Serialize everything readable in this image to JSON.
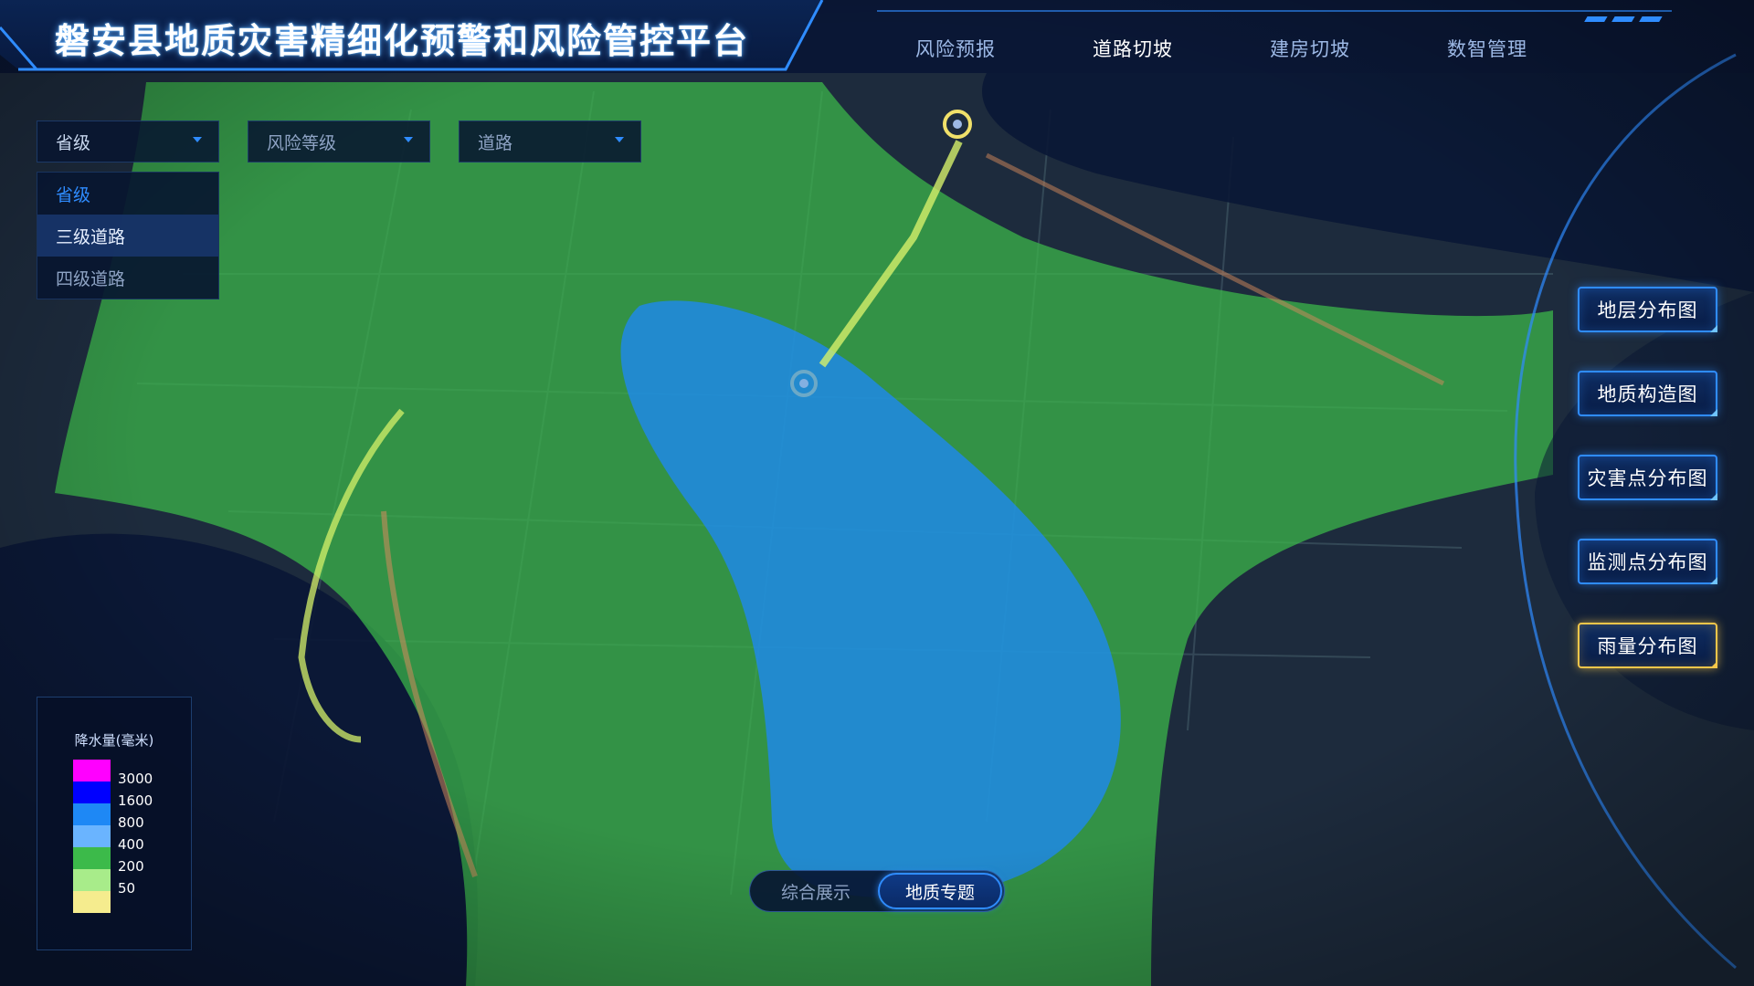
{
  "header": {
    "title": "磐安县地质灾害精细化预警和风险管控平台",
    "tabs": [
      {
        "label": "风险预报",
        "active": false
      },
      {
        "label": "道路切坡",
        "active": true
      },
      {
        "label": "建房切坡",
        "active": false
      },
      {
        "label": "数智管理",
        "active": false
      }
    ]
  },
  "filters": {
    "level": {
      "value": "省级",
      "icon": "chevron-down-icon"
    },
    "risk": {
      "value": "风险等级",
      "icon": "chevron-down-icon"
    },
    "road": {
      "value": "道路",
      "icon": "chevron-down-icon"
    },
    "level_options": [
      {
        "label": "省级",
        "state": "selected"
      },
      {
        "label": "三级道路",
        "state": "hover"
      },
      {
        "label": "四级道路",
        "state": "normal"
      }
    ]
  },
  "side_buttons": [
    {
      "label": "地层分布图",
      "active": false
    },
    {
      "label": "地质构造图",
      "active": false
    },
    {
      "label": "灾害点分布图",
      "active": false
    },
    {
      "label": "监测点分布图",
      "active": false
    },
    {
      "label": "雨量分布图",
      "active": true
    }
  ],
  "legend": {
    "title": "降水量(毫米)",
    "items": [
      {
        "color": "#ff00ff",
        "label": "3000"
      },
      {
        "color": "#0000ff",
        "label": "1600"
      },
      {
        "color": "#1e88f5",
        "label": "800"
      },
      {
        "color": "#6ab4ff",
        "label": "400"
      },
      {
        "color": "#3cba4a",
        "label": "200"
      },
      {
        "color": "#a8ec8a",
        "label": "50"
      },
      {
        "color": "#f5ec8e",
        "label": ""
      }
    ]
  },
  "mode_toggle": {
    "options": [
      {
        "label": "综合展示",
        "active": false
      },
      {
        "label": "地质专题",
        "active": true
      }
    ]
  },
  "map": {
    "pins": [
      "location-pin-icon",
      "location-pin-icon"
    ],
    "rain_colors": {
      "green": "#3cba4a",
      "blue": "#1e88f5"
    }
  },
  "colors": {
    "accent": "#2f8cff",
    "active_gold": "#f3c64a",
    "background": "#06102a"
  }
}
